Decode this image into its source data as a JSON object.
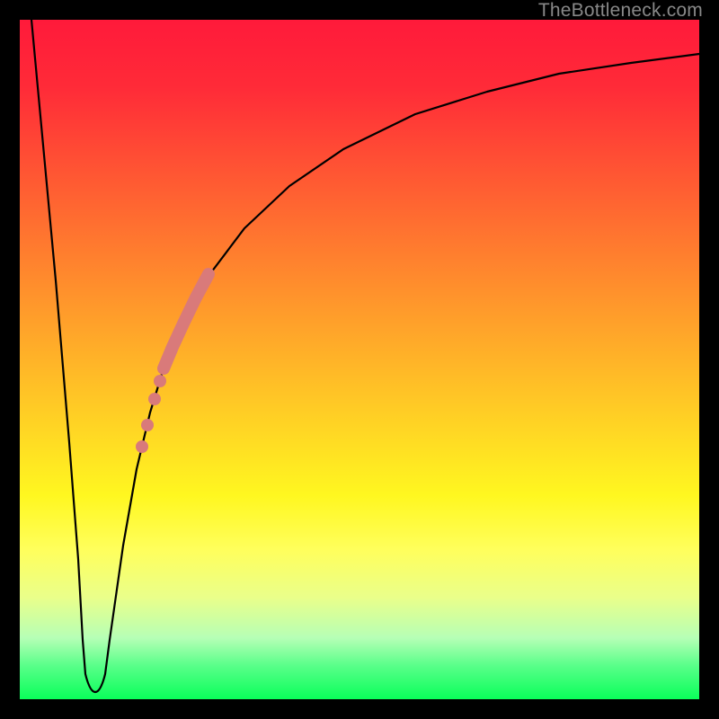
{
  "watermark": {
    "text": "TheBottleneck.com"
  },
  "colors": {
    "highlight": "#d97a7a",
    "curve": "#000000",
    "frame": "#000000"
  },
  "chart_data": {
    "type": "line",
    "title": "",
    "xlabel": "",
    "ylabel": "",
    "xlim": [
      0,
      100
    ],
    "ylim": [
      0,
      100
    ],
    "grid": false,
    "legend": false,
    "series": [
      {
        "name": "bottleneck-curve",
        "x": [
          0,
          3,
          6,
          8,
          9,
          10,
          11,
          12,
          14,
          16,
          18,
          20,
          22,
          25,
          30,
          35,
          40,
          50,
          60,
          70,
          80,
          90,
          100
        ],
        "y": [
          100,
          62,
          24,
          6,
          2,
          1,
          2,
          6,
          16,
          27,
          36,
          44,
          50,
          58,
          67,
          74,
          79,
          85,
          89,
          92,
          94,
          95.5,
          96.5
        ]
      }
    ],
    "highlight_segment": {
      "name": "scatter-overlay",
      "approximate": true,
      "points": [
        {
          "x": 17.0,
          "y": 31
        },
        {
          "x": 17.8,
          "y": 34
        },
        {
          "x": 18.5,
          "y": 37
        },
        {
          "x": 19.8,
          "y": 42
        },
        {
          "x": 21.5,
          "y": 48
        },
        {
          "x": 23.5,
          "y": 55
        },
        {
          "x": 25.0,
          "y": 59
        },
        {
          "x": 26.5,
          "y": 62
        }
      ],
      "kind": "thick-path-with-trailing-dots"
    }
  }
}
